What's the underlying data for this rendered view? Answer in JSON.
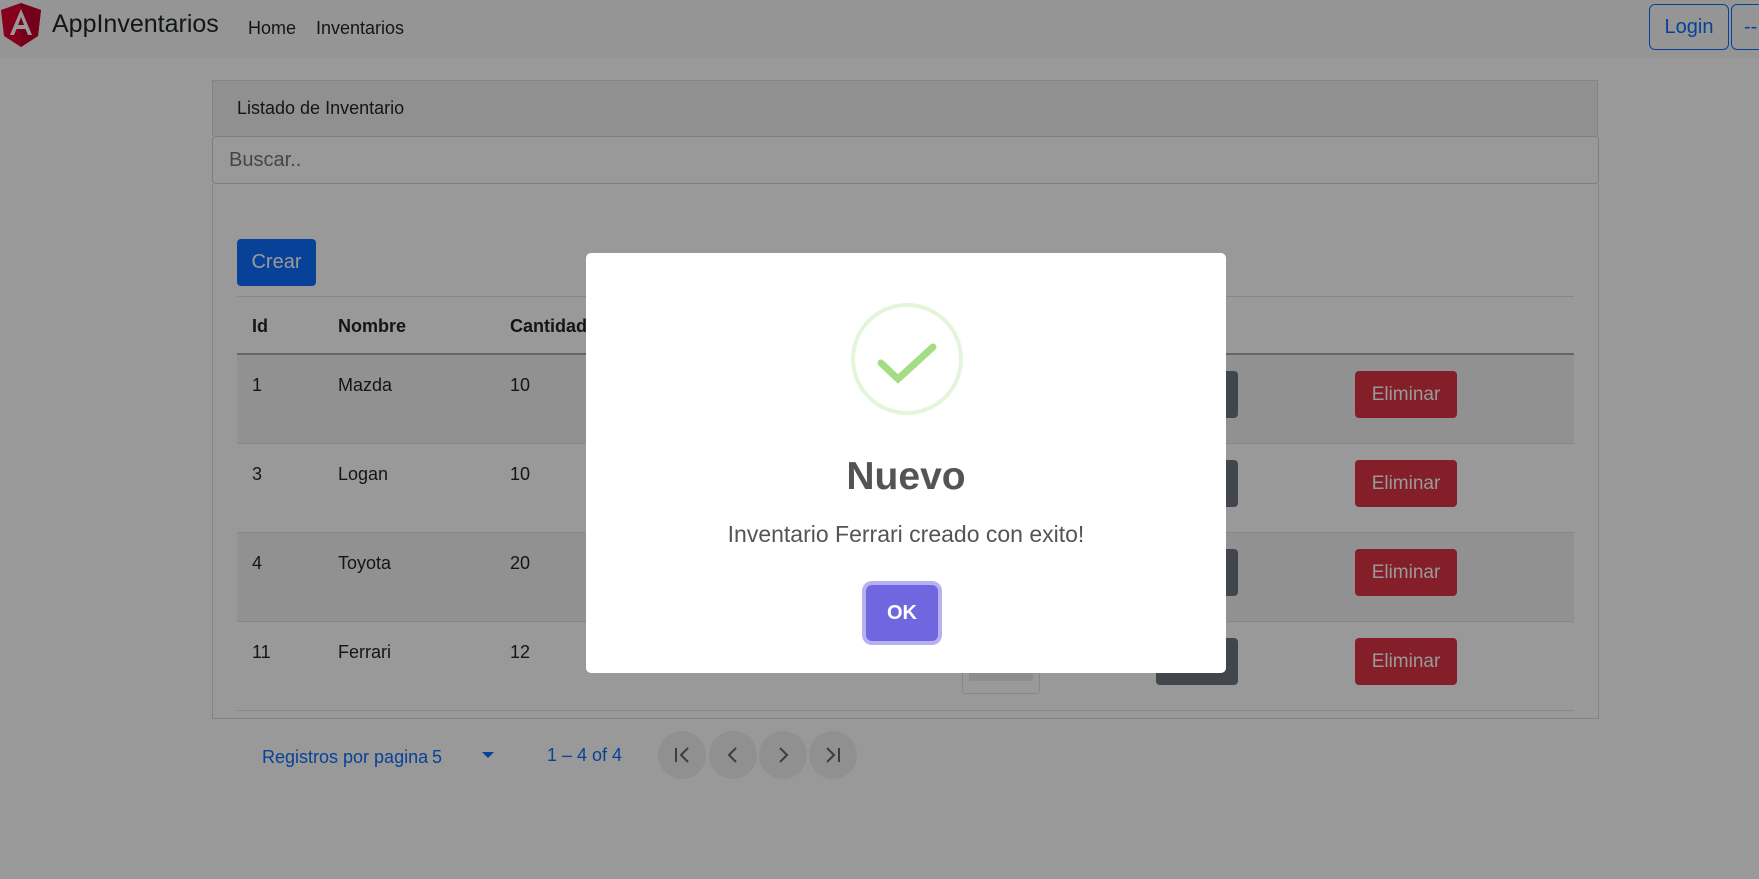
{
  "navbar": {
    "brand": "AppInventarios",
    "links": [
      "Home",
      "Inventarios"
    ],
    "login_label": "Login",
    "extra_label": "--"
  },
  "card": {
    "title": "Listado de Inventario",
    "search_placeholder": "Buscar.."
  },
  "create_button": "Crear",
  "table": {
    "headers": [
      "Id",
      "Nombre",
      "Cantidad"
    ],
    "rows": [
      {
        "id": "1",
        "nombre": "Mazda",
        "cantidad": "10",
        "delete": "Eliminar"
      },
      {
        "id": "3",
        "nombre": "Logan",
        "cantidad": "10",
        "delete": "Eliminar"
      },
      {
        "id": "4",
        "nombre": "Toyota",
        "cantidad": "20",
        "delete": "Eliminar"
      },
      {
        "id": "11",
        "nombre": "Ferrari",
        "cantidad": "12",
        "delete": "Eliminar"
      }
    ]
  },
  "paginator": {
    "label": "Registros por pagina",
    "page_size": "5",
    "range": "1 – 4 of 4",
    "icons": [
      "first-page-icon",
      "previous-page-icon",
      "next-page-icon",
      "last-page-icon"
    ]
  },
  "modal": {
    "icon": "success-check-icon",
    "title": "Nuevo",
    "message": "Inventario Ferrari creado con exito!",
    "ok_label": "OK"
  },
  "colors": {
    "primary": "#0d6efd",
    "danger": "#dc3545",
    "secondary": "#6c757d",
    "confirm": "#7066e0",
    "success": "#a5dc86",
    "angular_red": "#dd0031"
  }
}
